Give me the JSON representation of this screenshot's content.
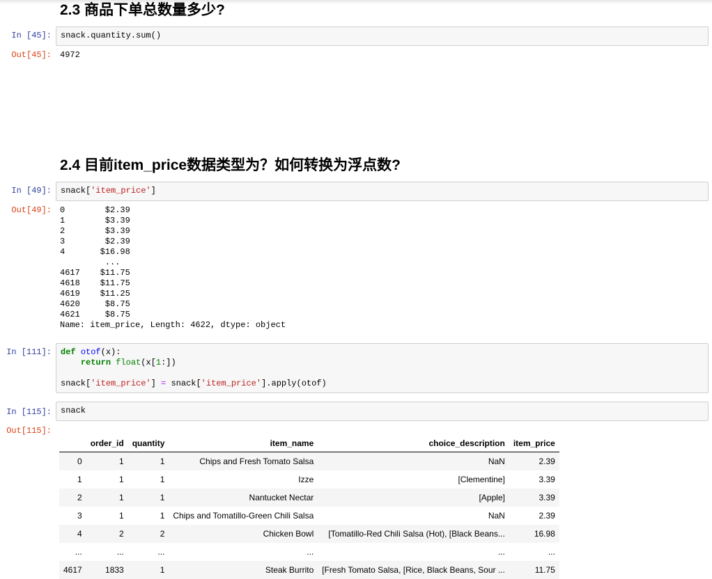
{
  "sections": [
    {
      "heading": "2.3  商品下单总数量多少?"
    },
    {
      "heading": "2.4  目前item_price数据类型为？如何转换为浮点数?"
    }
  ],
  "cells": {
    "c45": {
      "in": "In  [45]:",
      "code": "snack.quantity.sum()",
      "out_prompt": "Out[45]:",
      "output": "4972"
    },
    "c49": {
      "in": "In  [49]:",
      "code_pre": "snack[",
      "code_str": "'item_price'",
      "code_post": "]",
      "out_prompt": "Out[49]:",
      "output": "0        $2.39\n1        $3.39\n2        $3.39\n3        $2.39\n4       $16.98\n         ...  \n4617    $11.75\n4618    $11.75\n4619    $11.25\n4620     $8.75\n4621     $8.75\nName: item_price, Length: 4622, dtype: object"
    },
    "c111": {
      "in": "In  [111]:",
      "def": "def",
      "fname": "otof",
      "args": "(x):",
      "ret": "return",
      "float": "float",
      "x_open": "(x[",
      "one": "1",
      "x_close": ":])",
      "l3a": "snack[",
      "s1": "'item_price'",
      "l3b": "] ",
      "eq": "=",
      "l3c": " snack[",
      "s2": "'item_price'",
      "l3d": "].apply(otof)"
    },
    "c115": {
      "in": "In  [115]:",
      "code": "snack",
      "out_prompt": "Out[115]:"
    }
  },
  "table": {
    "columns": [
      "",
      "order_id",
      "quantity",
      "item_name",
      "choice_description",
      "item_price"
    ],
    "rows": [
      [
        "0",
        "1",
        "1",
        "Chips and Fresh Tomato Salsa",
        "NaN",
        "2.39"
      ],
      [
        "1",
        "1",
        "1",
        "Izze",
        "[Clementine]",
        "3.39"
      ],
      [
        "2",
        "1",
        "1",
        "Nantucket Nectar",
        "[Apple]",
        "3.39"
      ],
      [
        "3",
        "1",
        "1",
        "Chips and Tomatillo-Green Chili Salsa",
        "NaN",
        "2.39"
      ],
      [
        "4",
        "2",
        "2",
        "Chicken Bowl",
        "[Tomatillo-Red Chili Salsa (Hot), [Black Beans...",
        "16.98"
      ],
      [
        "...",
        "...",
        "...",
        "...",
        "...",
        "..."
      ],
      [
        "4617",
        "1833",
        "1",
        "Steak Burrito",
        "[Fresh Tomato Salsa, [Rice, Black Beans, Sour ...",
        "11.75"
      ]
    ]
  }
}
